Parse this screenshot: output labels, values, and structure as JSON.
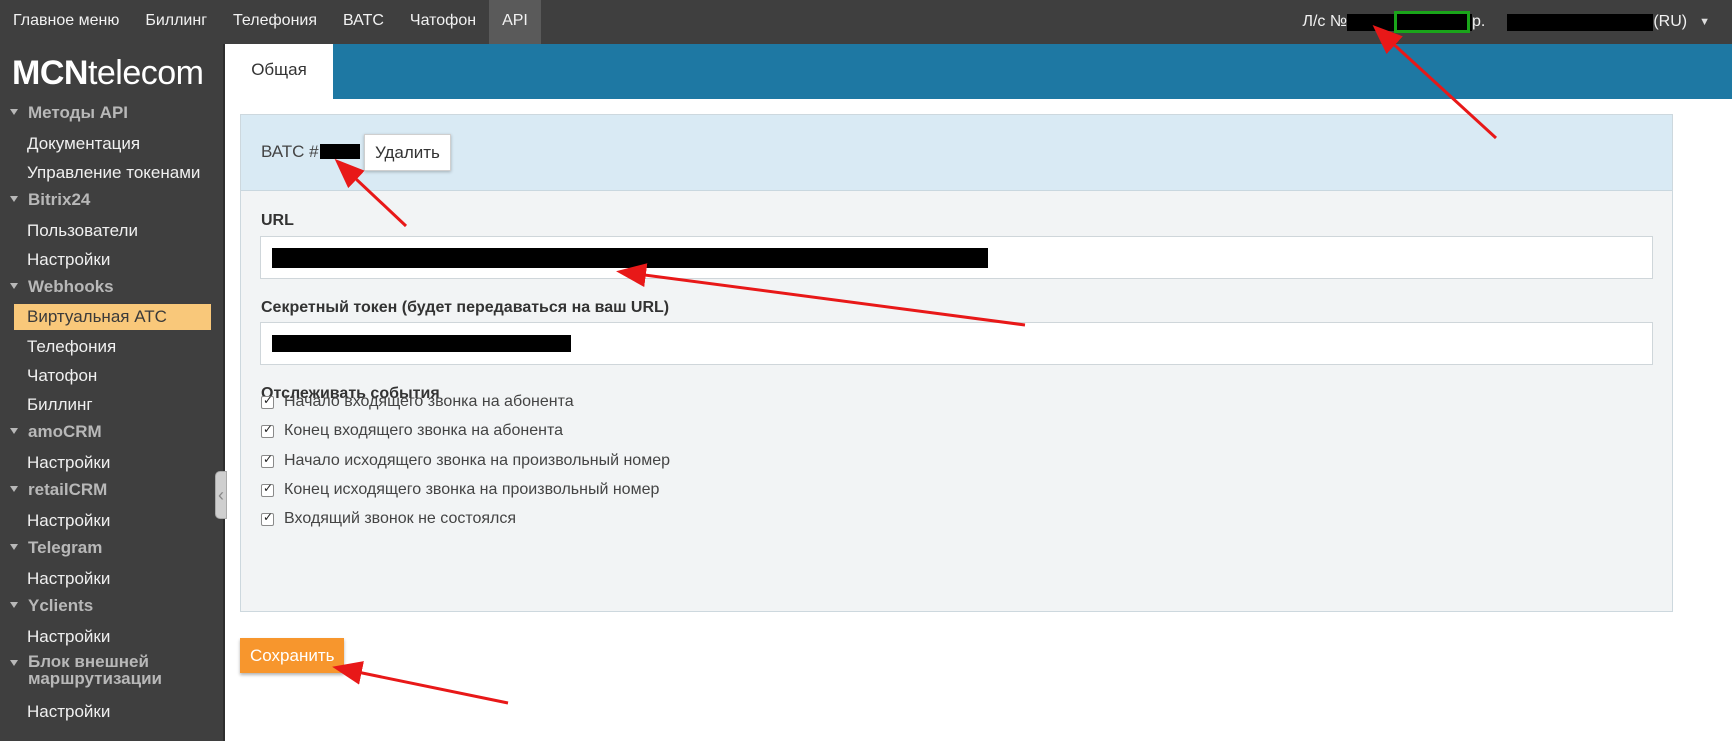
{
  "topnav": {
    "items": [
      "Главное меню",
      "Биллинг",
      "Телефония",
      "ВАТС",
      "Чатофон",
      "API"
    ],
    "active_index": 5
  },
  "account": {
    "label": "Л/с №",
    "currency": "р.",
    "lang": "(RU)"
  },
  "sidebar": {
    "logo_bold": "MCN",
    "logo_rest": "telecom",
    "sections": [
      {
        "title": "Методы API",
        "items": [
          "Документация",
          "Управление токенами"
        ]
      },
      {
        "title": "Bitrix24",
        "items": [
          "Пользователи",
          "Настройки"
        ]
      },
      {
        "title": "Webhooks",
        "items": [
          "Виртуальная АТС",
          "Телефония",
          "Чатофон",
          "Биллинг"
        ]
      },
      {
        "title": "amoCRM",
        "items": [
          "Настройки"
        ]
      },
      {
        "title": "retailCRM",
        "items": [
          "Настройки"
        ]
      },
      {
        "title": "Telegram",
        "items": [
          "Настройки"
        ]
      },
      {
        "title": "Yclients",
        "items": [
          "Настройки"
        ]
      },
      {
        "title": "Блок внешней маршрутизации",
        "items": [
          "Настройки"
        ]
      }
    ],
    "active_item": "Виртуальная АТС"
  },
  "header": {
    "tab_label": "Общая"
  },
  "panel": {
    "vats_label": "ВАТС #",
    "delete_label": "Удалить",
    "url_label": "URL",
    "token_label": "Секретный токен (будет передаваться на ваш URL)",
    "events_title": "Отслеживать события",
    "events": [
      {
        "label": "Начало входящего звонка на абонента",
        "checked": true
      },
      {
        "label": "Конец входящего звонка на абонента",
        "checked": true
      },
      {
        "label": "Начало исходящего звонка на произвольный номер",
        "checked": true
      },
      {
        "label": "Конец исходящего звонка на произвольный номер",
        "checked": true
      },
      {
        "label": "Входящий звонок не состоялся",
        "checked": true
      }
    ]
  },
  "save_label": "Сохранить",
  "colors": {
    "topbar": "#3f3f3f",
    "header_strip": "#1e78a3",
    "active_item": "#f9c87a",
    "save_button": "#f7962d",
    "annotation_arrow": "#e81818"
  }
}
